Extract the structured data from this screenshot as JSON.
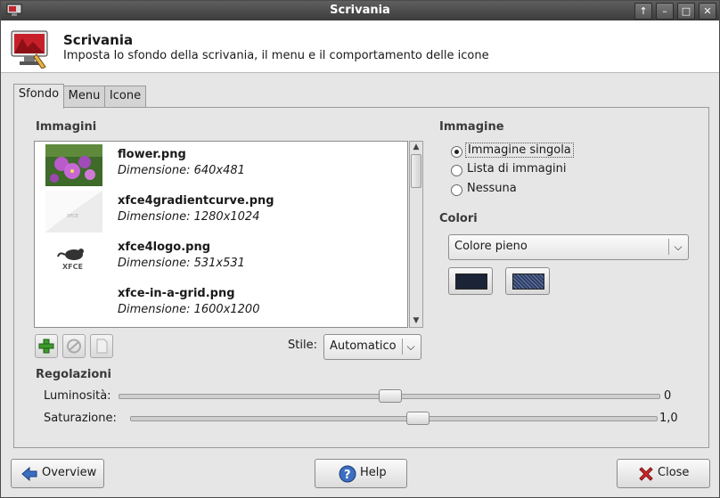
{
  "window": {
    "title": "Scrivania"
  },
  "titlebar_buttons": {
    "up": "↑",
    "minimize": "–",
    "maximize": "□",
    "close": "✕"
  },
  "header": {
    "title": "Scrivania",
    "subtitle": "Imposta lo sfondo della scrivania, il menu e il comportamento delle icone"
  },
  "tabs": [
    {
      "label": "Sfondo",
      "active": true
    },
    {
      "label": "Menu",
      "active": false
    },
    {
      "label": "Icone",
      "active": false
    }
  ],
  "images_section": {
    "heading": "Immagini",
    "items": [
      {
        "name": "flower.png",
        "dimension": "Dimensione: 640x481",
        "thumb": "flower-thumbnail"
      },
      {
        "name": "xfce4gradientcurve.png",
        "dimension": "Dimensione: 1280x1024",
        "thumb": "gradient-thumbnail"
      },
      {
        "name": "xfce4logo.png",
        "dimension": "Dimensione: 531x531",
        "thumb": "xfce-logo-thumbnail"
      },
      {
        "name": "xfce-in-a-grid.png",
        "dimension": "Dimensione: 1600x1200",
        "thumb": "grid-thumbnail"
      }
    ],
    "style_label": "Stile:",
    "style_value": "Automatico"
  },
  "image_section": {
    "heading": "Immagine",
    "options": [
      {
        "label": "Immagine singola",
        "selected": true
      },
      {
        "label": "Lista di immagini",
        "selected": false
      },
      {
        "label": "Nessuna",
        "selected": false
      }
    ]
  },
  "colors_section": {
    "heading": "Colori",
    "mode": "Colore pieno",
    "color1": "#1b2436",
    "color2": "#2e3f66"
  },
  "adjustments": {
    "heading": "Regolazioni",
    "brightness_label": "Luminosità:",
    "brightness_value": "0",
    "saturation_label": "Saturazione:",
    "saturation_value": "1,0"
  },
  "buttons": {
    "overview": "Overview",
    "help": "Help",
    "close": "Close"
  }
}
